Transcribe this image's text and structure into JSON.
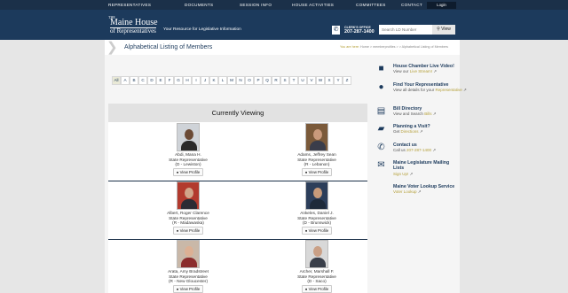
{
  "nav": {
    "items": [
      "Representatives",
      "Documents",
      "Session Info",
      "House Activities",
      "Committees",
      "Contact"
    ],
    "login": "Login"
  },
  "header": {
    "logo_the": "THE",
    "logo_line1": "Maine House",
    "logo_line2": "of Representatives",
    "tagline": "Your Resource for Legislative Information",
    "clerk_label": "CLERK'S OFFICE",
    "clerk_phone": "207-287-1400",
    "search_placeholder": "Search LD Number",
    "search_button": "View"
  },
  "page": {
    "title": "Alphabetical Listing of Members",
    "breadcrumb_here": "You are here:",
    "breadcrumb_path": "Home > memberprofiles > > Alphabetical Listing of Members"
  },
  "alphabet": [
    "All",
    "A",
    "B",
    "C",
    "D",
    "E",
    "F",
    "G",
    "H",
    "I",
    "J",
    "K",
    "L",
    "M",
    "N",
    "O",
    "P",
    "Q",
    "R",
    "S",
    "T",
    "U",
    "V",
    "W",
    "X",
    "Y",
    "Z"
  ],
  "viewing_title": "Currently Viewing",
  "members": [
    {
      "name": "Abdi, Mana H.",
      "role": "State Representative",
      "district": "(D - Lewiston)",
      "button": "View Profile",
      "skin": "#6b4a35",
      "shirt": "#2a2a2a",
      "bg": "#cfd3d8"
    },
    {
      "name": "Adams, Jeffrey Sean",
      "role": "State Representative",
      "district": "(R - Lebanon)",
      "button": "View Profile",
      "skin": "#c99a7c",
      "shirt": "#3a3d4a",
      "bg": "#7b5a3a"
    },
    {
      "name": "Albert, Roger Clarence",
      "role": "State Representative",
      "district": "(R - Madawaska)",
      "button": "View Profile",
      "skin": "#d1a58a",
      "shirt": "#2b2b33",
      "bg": "#b23a2e"
    },
    {
      "name": "Ankeles, Daniel J.",
      "role": "State Representative",
      "district": "(D - Brunswick)",
      "button": "View Profile",
      "skin": "#c79a7a",
      "shirt": "#1e2a3a",
      "bg": "#2c3e5a"
    },
    {
      "name": "Arata, Amy Bradstreet",
      "role": "State Representative",
      "district": "(R - New Gloucester)",
      "button": "View Profile",
      "skin": "#dcb094",
      "shirt": "#8b2d2d",
      "bg": "#c9b8a8"
    },
    {
      "name": "Archer, Marshall F.",
      "role": "State Representative",
      "district": "(D - Saco)",
      "button": "View Profile",
      "skin": "#caa086",
      "shirt": "#3a3f4a",
      "bg": "#d8d8d8"
    }
  ],
  "sidebar": [
    {
      "icon": "video-camera-icon",
      "glyph": "■",
      "title": "House Chamber Live Video!",
      "sub_text": "View our",
      "sub_link": "Live Stream!"
    },
    {
      "icon": "people-icon",
      "glyph": "●",
      "title": "Find Your Representative",
      "sub_text": "View all details for your",
      "sub_link": "Representative"
    },
    {
      "icon": "document-icon",
      "glyph": "▤",
      "title": "Bill Directory",
      "sub_text": "View and Search",
      "sub_link": "Bills"
    },
    {
      "icon": "map-icon",
      "glyph": "▰",
      "title": "Planning a Visit?",
      "sub_text": "Get",
      "sub_link": "Directions"
    },
    {
      "icon": "phone-icon",
      "glyph": "✆",
      "title": "Contact us",
      "sub_text": "Call us",
      "sub_link": "207-287-1400"
    },
    {
      "icon": "envelope-icon",
      "glyph": "✉",
      "title": "Maine Legislature Mailing Lists",
      "sub_text": "",
      "sub_link": "Sign Up!"
    },
    {
      "icon": "",
      "glyph": "",
      "title": "Maine Voter Lookup Service",
      "sub_text": "",
      "sub_link": "Voter Lookup"
    }
  ]
}
